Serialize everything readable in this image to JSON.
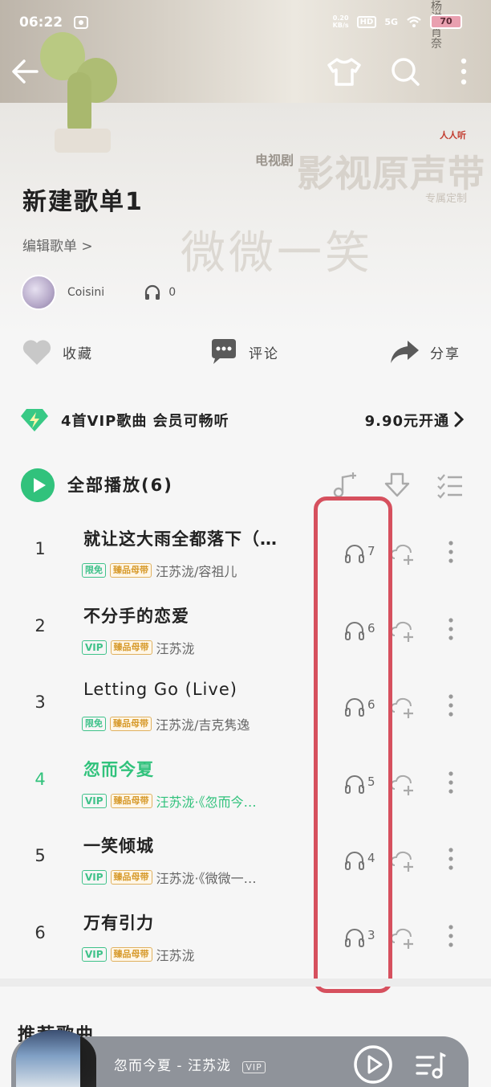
{
  "status_bar": {
    "time": "06:22",
    "net_speed_value": "0.20",
    "net_speed_unit": "KB/s",
    "hd": "HD",
    "signal": "5G",
    "battery": "70"
  },
  "poster": {
    "small_label": "电视剧",
    "title": "影视原声带",
    "brand": "人人听",
    "custom": "专属定制",
    "script_text": "微微一笑",
    "vertical_text": "杨洋 肖奈"
  },
  "playlist": {
    "title": "新建歌单1",
    "edit_label": "编辑歌单 >",
    "creator": "Coisini",
    "listen_count": "0"
  },
  "actions": {
    "favorite": "收藏",
    "comment": "评论",
    "share": "分享"
  },
  "vip_bar": {
    "text": "4首VIP歌曲 会员可畅听",
    "price": "9.90元开通"
  },
  "play_all": {
    "label": "全部播放(6)"
  },
  "songs": [
    {
      "index": "1",
      "title": "就让这大雨全都落下（…",
      "tag1": "限免",
      "tag2": "臻品母带",
      "artist": "汪苏泷/容祖儿",
      "plays": "7"
    },
    {
      "index": "2",
      "title": "不分手的恋爱",
      "tag1": "VIP",
      "tag2": "臻品母带",
      "artist": "汪苏泷",
      "plays": "6"
    },
    {
      "index": "3",
      "title": "Letting Go (Live)",
      "tag1": "限免",
      "tag2": "臻品母带",
      "artist": "汪苏泷/吉克隽逸",
      "plays": "6"
    },
    {
      "index": "4",
      "title": "忽而今夏",
      "tag1": "VIP",
      "tag2": "臻品母带",
      "artist": "汪苏泷·《忽而今…",
      "plays": "5"
    },
    {
      "index": "5",
      "title": "一笑倾城",
      "tag1": "VIP",
      "tag2": "臻品母带",
      "artist": "汪苏泷·《微微一…",
      "plays": "4"
    },
    {
      "index": "6",
      "title": "万有引力",
      "tag1": "VIP",
      "tag2": "臻品母带",
      "artist": "汪苏泷",
      "plays": "3"
    }
  ],
  "recommend": {
    "title": "推荐歌曲"
  },
  "mini_player": {
    "now_playing": "忽而今夏 - 汪苏泷",
    "badge": "VIP"
  },
  "colors": {
    "accent_green": "#31c27c",
    "highlight_red": "#d6505e",
    "master_gold": "#d79a2b"
  }
}
